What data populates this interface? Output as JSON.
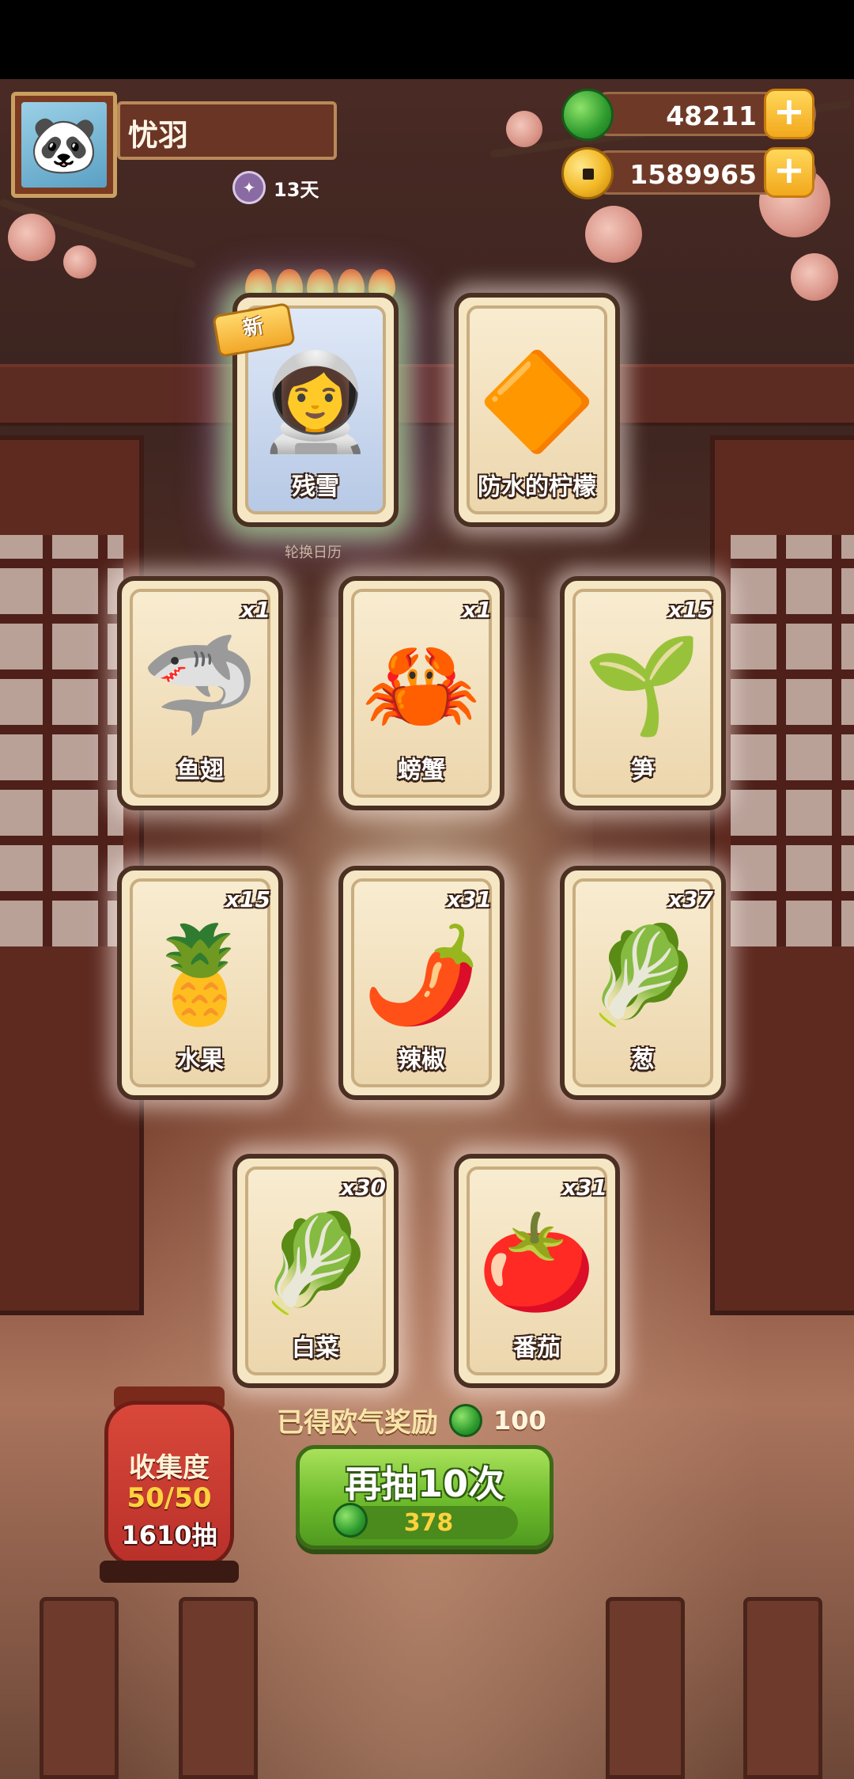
{
  "player": {
    "name": "忧羽",
    "days": "13天",
    "avatar_icon": "🐼"
  },
  "currency": {
    "jade": "48211",
    "coins": "1589965"
  },
  "calendar_label": "轮换日历",
  "cards": [
    {
      "id": "cancanxue",
      "title": "残雪",
      "count": "",
      "art": "👩‍🚀",
      "is_new": true,
      "new_label": "新",
      "rare": true
    },
    {
      "id": "lemon",
      "title": "防水的柠檬",
      "count": "",
      "art": "🔶"
    },
    {
      "id": "shark-fin",
      "title": "鱼翅",
      "count": "x1",
      "art": "🦈"
    },
    {
      "id": "crab",
      "title": "螃蟹",
      "count": "x1",
      "art": "🦀"
    },
    {
      "id": "bamboo",
      "title": "笋",
      "count": "x15",
      "art": "🌱"
    },
    {
      "id": "fruit",
      "title": "水果",
      "count": "x15",
      "art": "🍍"
    },
    {
      "id": "pepper",
      "title": "辣椒",
      "count": "x31",
      "art": "🌶️"
    },
    {
      "id": "scallion",
      "title": "葱",
      "count": "x37",
      "art": "🥬"
    },
    {
      "id": "cabbage",
      "title": "白菜",
      "count": "x30",
      "art": "🥬"
    },
    {
      "id": "tomato",
      "title": "番茄",
      "count": "x31",
      "art": "🍅"
    }
  ],
  "reward": {
    "label": "已得欧气奖励",
    "value": "100"
  },
  "draw_button": {
    "label": "再抽10次",
    "cost": "378"
  },
  "collection": {
    "label": "收集度",
    "progress": "50/50",
    "draws": "1610抽"
  },
  "colors": {
    "jade": "#2e9b2e",
    "coin": "#f2b825",
    "button_green": "#6dbb2c",
    "lantern_red": "#c0392b"
  }
}
